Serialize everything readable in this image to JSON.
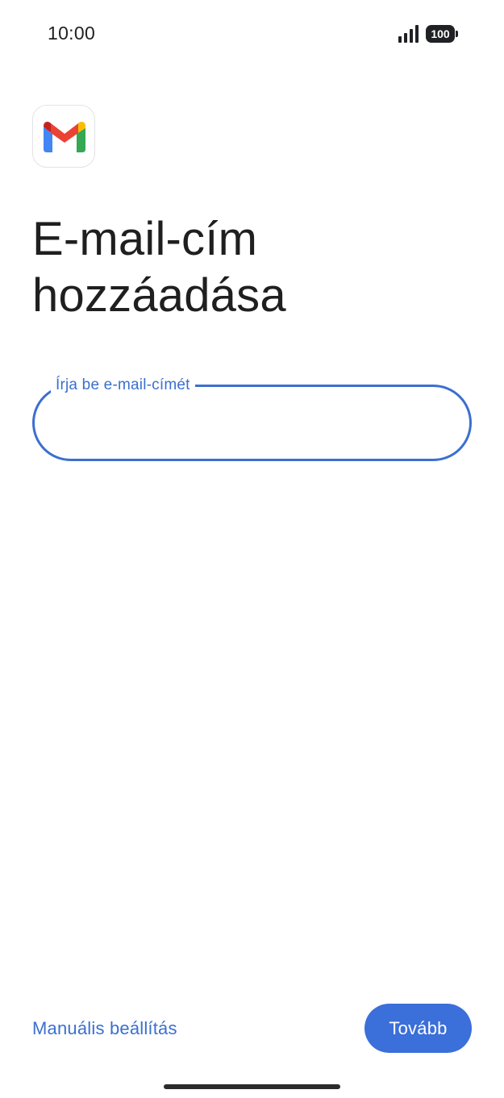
{
  "status_bar": {
    "time": "10:00",
    "battery": "100",
    "icons": [
      "signal-icon",
      "battery-icon"
    ]
  },
  "app": {
    "logo": "gmail-logo-icon",
    "colors": {
      "red": "#EA4335",
      "blue": "#4285F4",
      "green": "#34A853",
      "yellow": "#FBBC04"
    }
  },
  "page": {
    "title": "E-mail-cím hozzáadása"
  },
  "email_field": {
    "label": "Írja be e-mail-címét",
    "value": "",
    "accent_color": "#3B6FCF"
  },
  "footer": {
    "manual_setup_label": "Manuális beállítás",
    "next_label": "Tovább",
    "button_color": "#3B6FD9"
  }
}
